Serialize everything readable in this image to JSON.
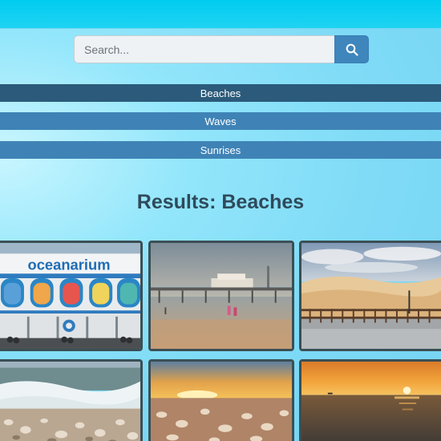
{
  "search": {
    "placeholder": "Search...",
    "icon": "search-icon"
  },
  "categories": [
    {
      "label": "Beaches",
      "active": true
    },
    {
      "label": "Waves",
      "active": false
    },
    {
      "label": "Sunrises",
      "active": false
    }
  ],
  "results": {
    "title": "Results: Beaches",
    "images": [
      {
        "name": "oceanarium-building",
        "sign_text": "oceanarium"
      },
      {
        "name": "pier-beach"
      },
      {
        "name": "dunes-promenade"
      },
      {
        "name": "shell-beach-waves"
      },
      {
        "name": "sunset-pebbles"
      },
      {
        "name": "sunset-sea"
      }
    ]
  },
  "colors": {
    "nav_active": "#2b5a7a",
    "nav_inactive": "#3f83b6",
    "search_button": "#3f86bd",
    "title": "#2f4a5c"
  }
}
